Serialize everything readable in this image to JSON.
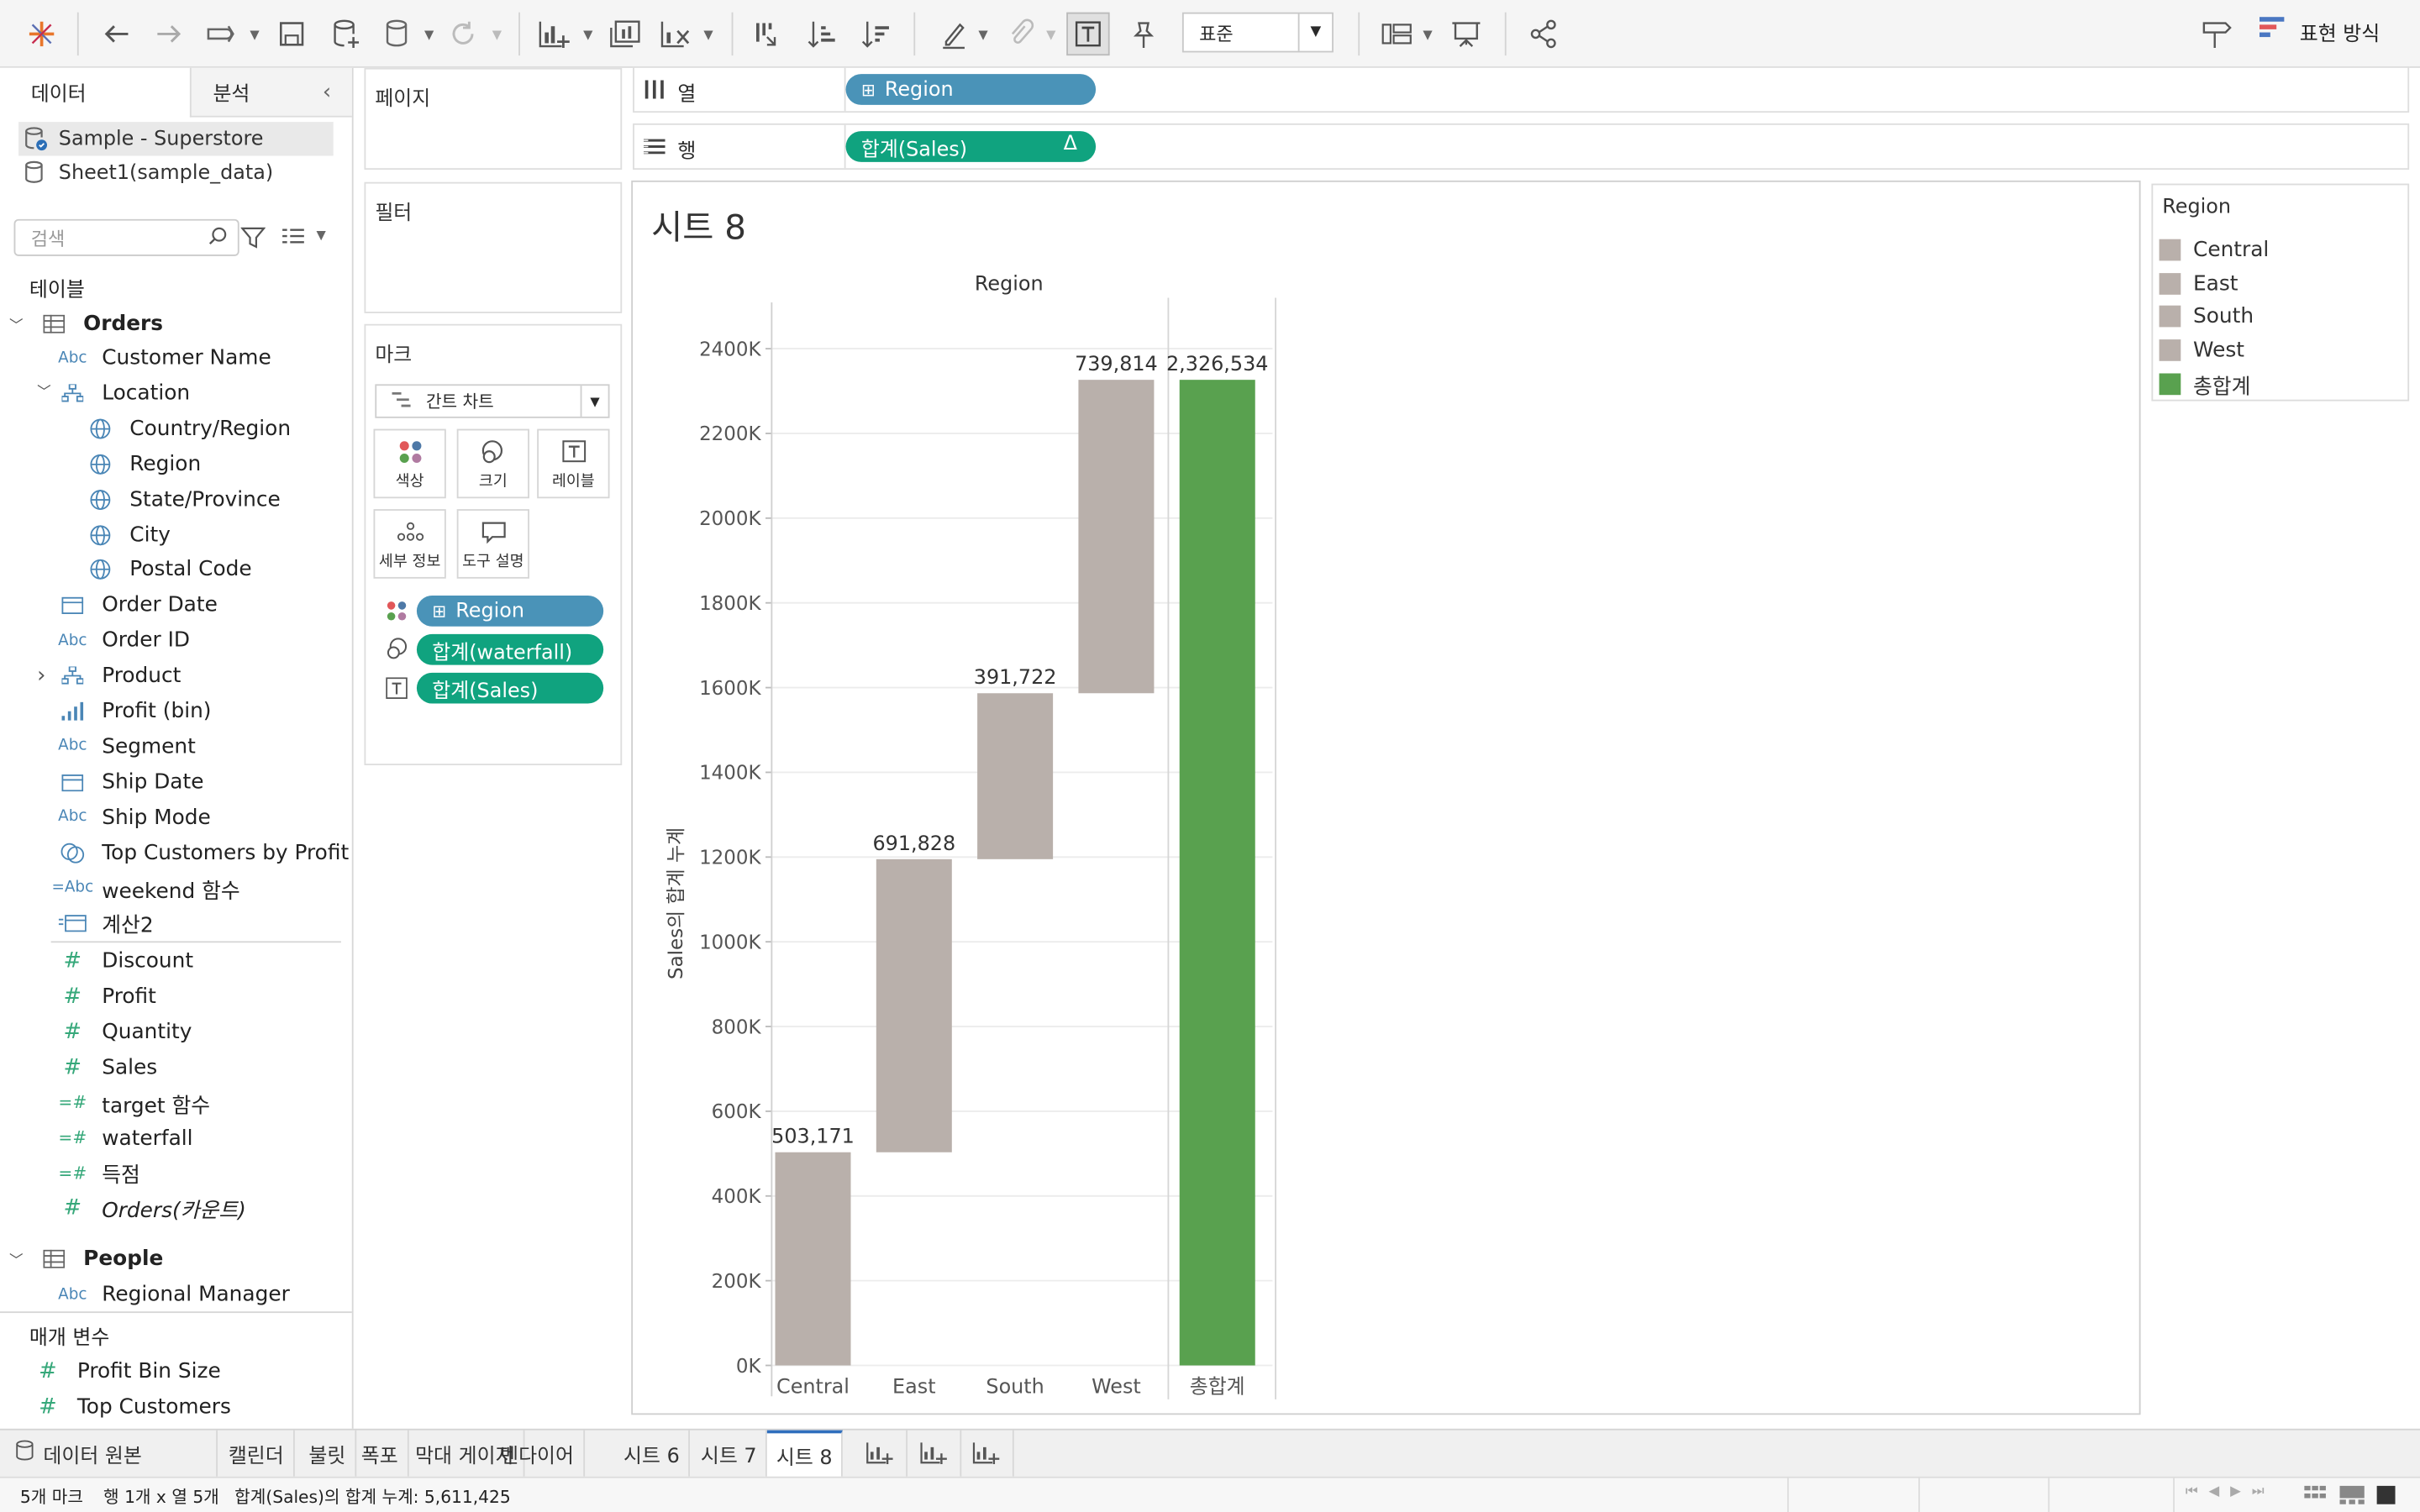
{
  "toolbar": {
    "fit_value": "표준",
    "show_me_label": "표현 방식"
  },
  "left_pane": {
    "tabs": [
      "데이터",
      "분석"
    ],
    "data_sources": [
      "Sample - Superstore",
      "Sheet1(sample_data)"
    ],
    "search_placeholder": "검색",
    "tables_header": "테이블",
    "orders_table": "Orders",
    "fields": [
      {
        "name": "Customer Name",
        "icon": "Abc"
      },
      {
        "name": "Location",
        "icon": "hierarchy-icon"
      },
      {
        "name": "Country/Region",
        "icon": "globe-icon"
      },
      {
        "name": "Region",
        "icon": "globe-icon"
      },
      {
        "name": "State/Province",
        "icon": "globe-icon"
      },
      {
        "name": "City",
        "icon": "globe-icon"
      },
      {
        "name": "Postal Code",
        "icon": "globe-icon"
      },
      {
        "name": "Order Date",
        "icon": "calendar-icon"
      },
      {
        "name": "Order ID",
        "icon": "Abc"
      },
      {
        "name": "Product",
        "icon": "hierarchy-icon"
      },
      {
        "name": "Profit (bin)",
        "icon": "bin-icon"
      },
      {
        "name": "Segment",
        "icon": "Abc"
      },
      {
        "name": "Ship Date",
        "icon": "calendar-icon"
      },
      {
        "name": "Ship Mode",
        "icon": "Abc"
      },
      {
        "name": "Top Customers by Profit",
        "icon": "set-icon"
      },
      {
        "name": "weekend 함수",
        "icon": "=Abc"
      },
      {
        "name": "계산2",
        "icon": "=calendar-icon"
      }
    ],
    "measures": [
      {
        "name": "Discount",
        "icon": "#"
      },
      {
        "name": "Profit",
        "icon": "#"
      },
      {
        "name": "Quantity",
        "icon": "#"
      },
      {
        "name": "Sales",
        "icon": "#"
      },
      {
        "name": "target 함수",
        "icon": "=#"
      },
      {
        "name": "waterfall",
        "icon": "=#"
      },
      {
        "name": "득점",
        "icon": "=#"
      },
      {
        "name": "Orders(카운트)",
        "icon": "#"
      }
    ],
    "people_table": "People",
    "people_fields": [
      {
        "name": "Regional Manager",
        "icon": "Abc"
      }
    ],
    "params_header": "매개 변수",
    "params": [
      {
        "name": "Profit Bin Size",
        "icon": "#"
      },
      {
        "name": "Top Customers",
        "icon": "#"
      }
    ]
  },
  "cards": {
    "pages_title": "페이지",
    "filters_title": "필터",
    "marks_title": "마크",
    "mark_type": "간트 차트",
    "mark_buttons": [
      "색상",
      "크기",
      "레이블",
      "세부 정보",
      "도구 설명"
    ],
    "mark_pills": [
      "Region",
      "합계(waterfall)",
      "합계(Sales)"
    ]
  },
  "shelves": {
    "columns_label": "열",
    "columns_pill": "Region",
    "rows_label": "행",
    "rows_pill": "합계(Sales)",
    "rows_pill_delta": "Δ"
  },
  "sheet_title": "시트 8",
  "legend": {
    "title": "Region",
    "items": [
      {
        "label": "Central",
        "color": "#b9b0ab"
      },
      {
        "label": "East",
        "color": "#b9b0ab"
      },
      {
        "label": "South",
        "color": "#b9b0ab"
      },
      {
        "label": "West",
        "color": "#b9b0ab"
      },
      {
        "label": "총합계",
        "color": "#59a14f"
      }
    ]
  },
  "chart_data": {
    "type": "bar",
    "subtype": "waterfall",
    "header": "Region",
    "ylabel": "Sales의 합계 누계",
    "categories": [
      "Central",
      "East",
      "South",
      "West",
      "총합계"
    ],
    "values": [
      503171,
      691828,
      391722,
      739814,
      2326534
    ],
    "value_labels": [
      "503,171",
      "691,828",
      "391,722",
      "739,814",
      "2,326,534"
    ],
    "y_ticks": [
      "0K",
      "200K",
      "400K",
      "600K",
      "800K",
      "1000K",
      "1200K",
      "1400K",
      "1600K",
      "1800K",
      "2000K",
      "2200K",
      "2400K"
    ],
    "ylim": [
      0,
      2400000
    ],
    "bar_color": "#b9b0ab",
    "total_color": "#59a14f",
    "grid": true
  },
  "tabs": {
    "datasource": "데이터 원본",
    "sheets": [
      "캘린더",
      "불릿",
      "폭포",
      "막대 게이지",
      "벤다이어",
      "시트 6",
      "시트 7",
      "시트 8"
    ],
    "active": "시트 8"
  },
  "status": {
    "marks": "5개 마크",
    "rows_cols": "행 1개 x 열 5개",
    "sum": "합계(Sales)의 합계 누계: 5,611,425"
  }
}
